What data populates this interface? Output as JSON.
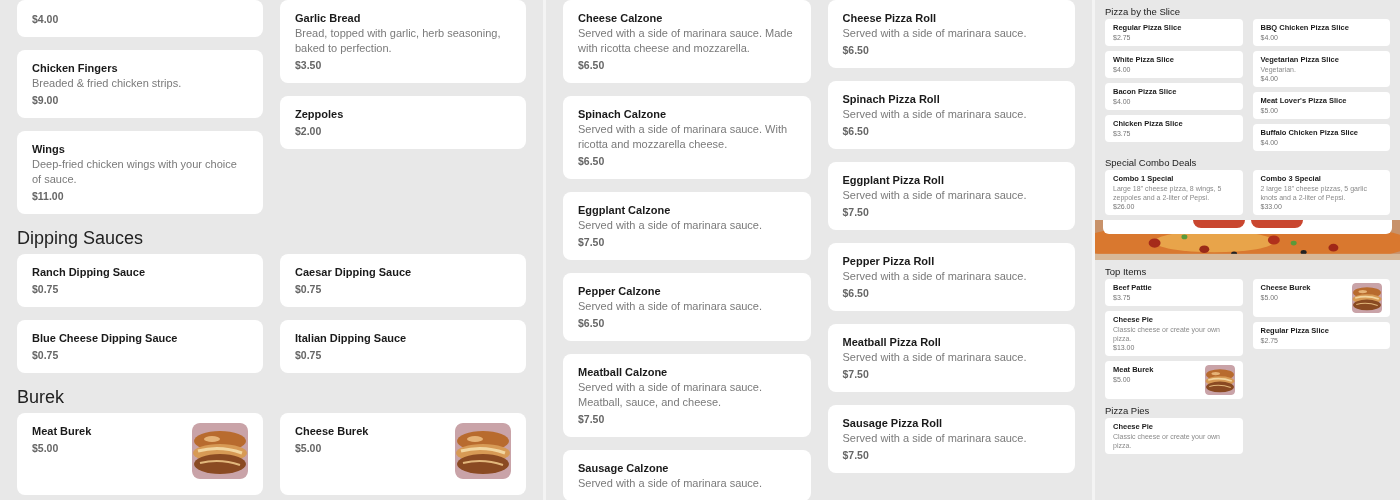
{
  "panels": [
    {
      "compact": false,
      "sections": [
        {
          "columns": [
            [
              {
                "kind": "plain",
                "price": "$4.00"
              },
              {
                "kind": "plain",
                "name": "Chicken Fingers",
                "description": "Breaded & fried chicken strips.",
                "price": "$9.00"
              },
              {
                "kind": "plain",
                "name": "Wings",
                "description": "Deep-fried chicken wings with your choice of sauce.",
                "price": "$11.00"
              }
            ],
            [
              {
                "kind": "plain",
                "name": "Garlic Bread",
                "description": "Bread, topped with garlic, herb seasoning, baked to perfection.",
                "price": "$3.50"
              },
              {
                "kind": "plain",
                "name": "Zeppoles",
                "price": "$2.00"
              }
            ]
          ]
        },
        {
          "heading": "Dipping Sauces",
          "columns": [
            [
              {
                "kind": "plain",
                "name": "Ranch Dipping Sauce",
                "price": "$0.75"
              },
              {
                "kind": "plain",
                "name": "Blue Cheese Dipping Sauce",
                "price": "$0.75"
              }
            ],
            [
              {
                "kind": "plain",
                "name": "Caesar Dipping Sauce",
                "price": "$0.75"
              },
              {
                "kind": "plain",
                "name": "Italian Dipping Sauce",
                "price": "$0.75"
              }
            ]
          ]
        },
        {
          "heading": "Burek",
          "columns": [
            [
              {
                "kind": "with_image",
                "name": "Meat Burek",
                "price": "$5.00"
              }
            ],
            [
              {
                "kind": "with_image",
                "name": "Cheese Burek",
                "price": "$5.00"
              }
            ]
          ]
        }
      ]
    },
    {
      "compact": false,
      "sections": [
        {
          "columns": [
            [
              {
                "kind": "plain",
                "name": "Cheese Calzone",
                "description": "Served with a side of marinara sauce. Made with ricotta cheese and mozzarella.",
                "price": "$6.50"
              },
              {
                "kind": "plain",
                "name": "Spinach Calzone",
                "description": "Served with a side of marinara sauce. With ricotta and mozzarella cheese.",
                "price": "$6.50"
              },
              {
                "kind": "plain",
                "name": "Eggplant Calzone",
                "description": "Served with a side of marinara sauce.",
                "price": "$7.50"
              },
              {
                "kind": "plain",
                "name": "Pepper Calzone",
                "description": "Served with a side of marinara sauce.",
                "price": "$6.50"
              },
              {
                "kind": "plain",
                "name": "Meatball Calzone",
                "description": "Served with a side of marinara sauce. Meatball, sauce, and cheese.",
                "price": "$7.50"
              },
              {
                "kind": "plain",
                "name": "Sausage Calzone",
                "description": "Served with a side of marinara sauce."
              }
            ],
            [
              {
                "kind": "plain",
                "name": "Cheese Pizza Roll",
                "description": "Served with a side of marinara sauce.",
                "price": "$6.50"
              },
              {
                "kind": "plain",
                "name": "Spinach Pizza Roll",
                "description": "Served with a side of marinara sauce.",
                "price": "$6.50"
              },
              {
                "kind": "plain",
                "name": "Eggplant Pizza Roll",
                "description": "Served with a side of marinara sauce.",
                "price": "$7.50"
              },
              {
                "kind": "plain",
                "name": "Pepper Pizza Roll",
                "description": "Served with a side of marinara sauce.",
                "price": "$6.50"
              },
              {
                "kind": "plain",
                "name": "Meatball Pizza Roll",
                "description": "Served with a side of marinara sauce.",
                "price": "$7.50"
              },
              {
                "kind": "plain",
                "name": "Sausage Pizza Roll",
                "description": "Served with a side of marinara sauce.",
                "price": "$7.50"
              }
            ]
          ]
        }
      ]
    },
    {
      "compact": true,
      "sections": [
        {
          "heading": "Pizza by the Slice",
          "columns": [
            [
              {
                "kind": "plain",
                "name": "Regular Pizza Slice",
                "price": "$2.75"
              },
              {
                "kind": "plain",
                "name": "White Pizza Slice",
                "price": "$4.00"
              },
              {
                "kind": "plain",
                "name": "Bacon Pizza Slice",
                "price": "$4.00"
              },
              {
                "kind": "plain",
                "name": "Chicken Pizza Slice",
                "price": "$3.75"
              }
            ],
            [
              {
                "kind": "plain",
                "name": "BBQ Chicken Pizza Slice",
                "price": "$4.00"
              },
              {
                "kind": "plain",
                "name": "Vegetarian Pizza Slice",
                "description": "Vegetarian.",
                "price": "$4.00"
              },
              {
                "kind": "plain",
                "name": "Meat Lover's Pizza Slice",
                "price": "$5.00"
              },
              {
                "kind": "plain",
                "name": "Buffalo Chicken Pizza Slice",
                "price": "$4.00"
              }
            ]
          ]
        },
        {
          "heading": "Special Combo Deals",
          "columns": [
            [
              {
                "kind": "plain",
                "name": "Combo 1 Special",
                "description": "Large 18\" cheese pizza, 8 wings, 5 zeppoles and a 2-liter of Pepsi.",
                "price": "$26.00"
              }
            ],
            [
              {
                "kind": "plain",
                "name": "Combo 3 Special",
                "description": "2 large 18\" cheese pizzas, 5 garlic knots and a 2-liter of Pepsi.",
                "price": "$33.00"
              }
            ]
          ]
        },
        {
          "kind": "banner"
        },
        {
          "heading": "Top Items",
          "columns": [
            [
              {
                "kind": "plain",
                "name": "Beef Pattie",
                "price": "$3.75"
              },
              {
                "kind": "plain",
                "name": "Cheese Pie",
                "description": "Classic cheese or create your own pizza.",
                "price": "$13.00"
              },
              {
                "kind": "with_image",
                "name": "Meat Burek",
                "price": "$5.00"
              }
            ],
            [
              {
                "kind": "with_image",
                "name": "Cheese Burek",
                "price": "$5.00"
              },
              {
                "kind": "plain",
                "name": "Regular Pizza Slice",
                "price": "$2.75"
              }
            ]
          ]
        },
        {
          "heading": "Pizza Pies",
          "columns": [
            [
              {
                "kind": "plain",
                "name": "Cheese Pie",
                "description": "Classic cheese or create your own pizza."
              }
            ],
            []
          ]
        }
      ]
    }
  ]
}
